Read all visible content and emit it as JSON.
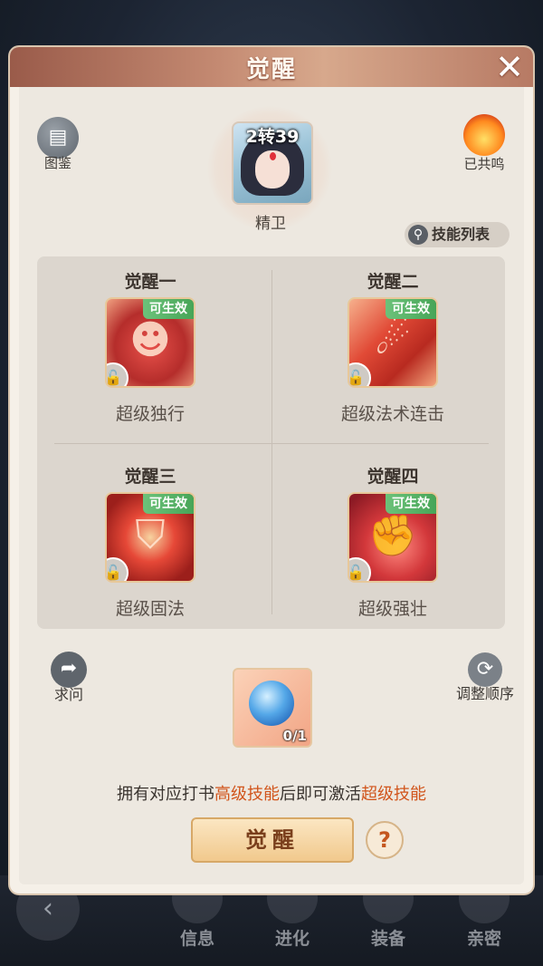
{
  "dialog": {
    "title": "觉醒",
    "close_icon": "close-icon"
  },
  "codex": {
    "label": "图鉴",
    "icon": "book-icon"
  },
  "resonance": {
    "label": "已共鸣",
    "icon": "flame-icon"
  },
  "hero": {
    "rank": "2转39",
    "name": "精卫"
  },
  "skill_list": {
    "label": "技能列表",
    "icon": "search-icon"
  },
  "awakenings": [
    {
      "title": "觉醒一",
      "tag": "可生效",
      "skill": "超级独行"
    },
    {
      "title": "觉醒二",
      "tag": "可生效",
      "skill": "超级法术连击"
    },
    {
      "title": "觉醒三",
      "tag": "可生效",
      "skill": "超级固法"
    },
    {
      "title": "觉醒四",
      "tag": "可生效",
      "skill": "超级强壮"
    }
  ],
  "ask": {
    "label": "求问",
    "icon": "share-arrow-icon"
  },
  "reorder": {
    "label": "调整顺序",
    "icon": "refresh-icon"
  },
  "item": {
    "count": "0/1"
  },
  "hint": {
    "part1": "拥有对应打书",
    "highlight1": "高级技能",
    "part2": "后即可激活",
    "highlight2": "超级技能"
  },
  "awaken_button": "觉醒",
  "help": "?",
  "bottom_nav": [
    "信息",
    "进化",
    "装备",
    "亲密"
  ]
}
